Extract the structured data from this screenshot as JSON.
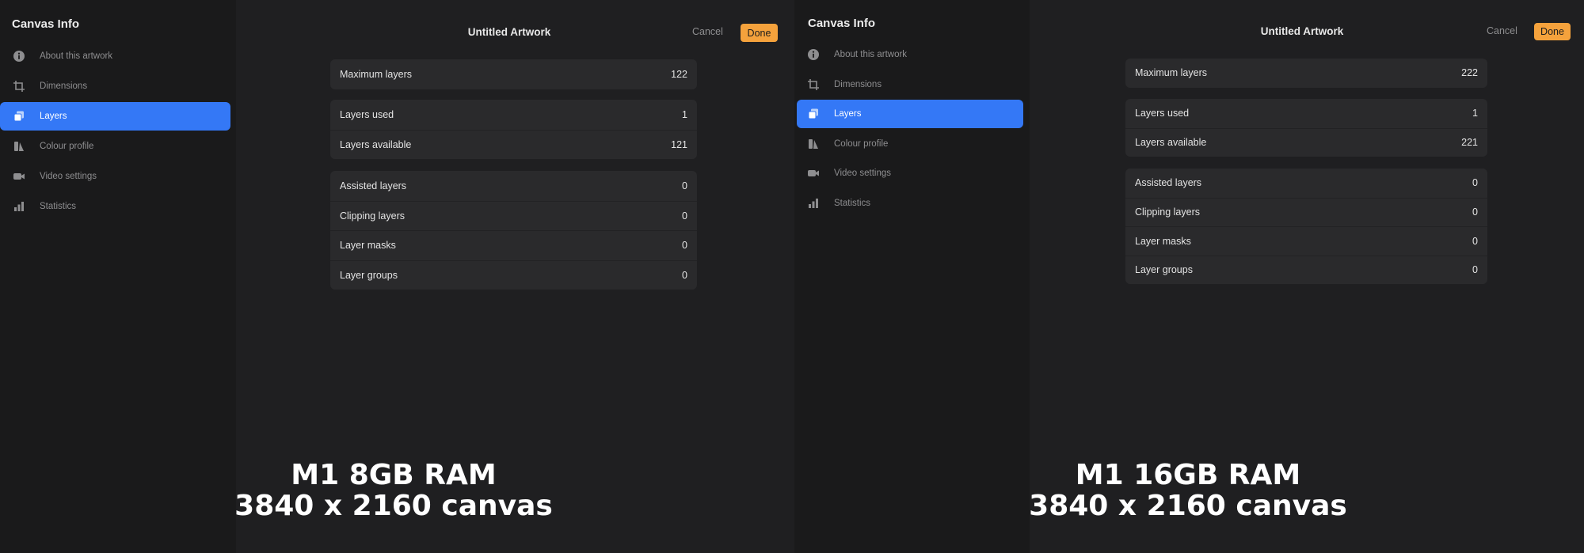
{
  "screens": [
    {
      "sidebar": {
        "title": "Canvas Info",
        "items": [
          {
            "label": "About this artwork",
            "icon": "info-icon"
          },
          {
            "label": "Dimensions",
            "icon": "crop-icon"
          },
          {
            "label": "Layers",
            "icon": "layers-icon",
            "active": true
          },
          {
            "label": "Colour profile",
            "icon": "palette-icon"
          },
          {
            "label": "Video settings",
            "icon": "video-camera-icon"
          },
          {
            "label": "Statistics",
            "icon": "bar-chart-icon"
          }
        ]
      },
      "header": {
        "title": "Untitled Artwork",
        "cancel": "Cancel",
        "done": "Done"
      },
      "groups": [
        [
          {
            "label": "Maximum layers",
            "value": "122"
          }
        ],
        [
          {
            "label": "Layers used",
            "value": "1"
          },
          {
            "label": "Layers available",
            "value": "121"
          }
        ],
        [
          {
            "label": "Assisted layers",
            "value": "0"
          },
          {
            "label": "Clipping layers",
            "value": "0"
          },
          {
            "label": "Layer masks",
            "value": "0"
          },
          {
            "label": "Layer groups",
            "value": "0"
          }
        ]
      ],
      "caption": {
        "line1": "M1 8GB RAM",
        "line2": "3840 x 2160 canvas"
      }
    },
    {
      "sidebar": {
        "title": "Canvas Info",
        "items": [
          {
            "label": "About this artwork",
            "icon": "info-icon"
          },
          {
            "label": "Dimensions",
            "icon": "crop-icon"
          },
          {
            "label": "Layers",
            "icon": "layers-icon",
            "active": true
          },
          {
            "label": "Colour profile",
            "icon": "palette-icon"
          },
          {
            "label": "Video settings",
            "icon": "video-camera-icon"
          },
          {
            "label": "Statistics",
            "icon": "bar-chart-icon"
          }
        ]
      },
      "header": {
        "title": "Untitled Artwork",
        "cancel": "Cancel",
        "done": "Done"
      },
      "groups": [
        [
          {
            "label": "Maximum layers",
            "value": "222"
          }
        ],
        [
          {
            "label": "Layers used",
            "value": "1"
          },
          {
            "label": "Layers available",
            "value": "221"
          }
        ],
        [
          {
            "label": "Assisted layers",
            "value": "0"
          },
          {
            "label": "Clipping layers",
            "value": "0"
          },
          {
            "label": "Layer masks",
            "value": "0"
          },
          {
            "label": "Layer groups",
            "value": "0"
          }
        ]
      ],
      "caption": {
        "line1": "M1 16GB RAM",
        "line2": "3840 x 2160 canvas"
      }
    }
  ],
  "colors": {
    "accent": "#3478f6",
    "done": "#f5a23c",
    "background": "#1c1c1e"
  }
}
